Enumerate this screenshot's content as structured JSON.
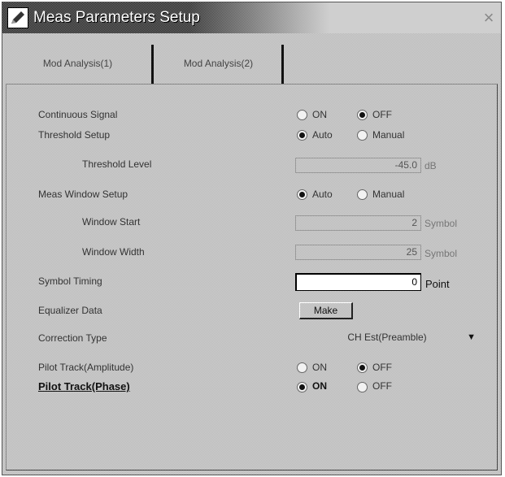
{
  "window": {
    "title": "Meas Parameters Setup",
    "close_glyph": "×"
  },
  "tabs": [
    {
      "label": "Mod Analysis(1)"
    },
    {
      "label": "Mod Analysis(2)"
    }
  ],
  "rows": {
    "continuous_signal": {
      "label": "Continuous Signal",
      "options": [
        "ON",
        "OFF"
      ],
      "selected": "OFF"
    },
    "threshold_setup": {
      "label": "Threshold Setup",
      "options": [
        "Auto",
        "Manual"
      ],
      "selected": "Auto"
    },
    "threshold_level": {
      "label": "Threshold Level",
      "value": "-45.0",
      "unit": "dB"
    },
    "meas_window_setup": {
      "label": "Meas Window Setup",
      "options": [
        "Auto",
        "Manual"
      ],
      "selected": "Auto"
    },
    "window_start": {
      "label": "Window Start",
      "value": "2",
      "unit": "Symbol"
    },
    "window_width": {
      "label": "Window Width",
      "value": "25",
      "unit": "Symbol"
    },
    "symbol_timing": {
      "label": "Symbol Timing",
      "value": "0",
      "unit": "Point"
    },
    "equalizer_data": {
      "label": "Equalizer Data",
      "button": "Make"
    },
    "correction_type": {
      "label": "Correction Type",
      "value": "CH Est(Preamble)"
    },
    "pilot_track_amplitude": {
      "label": "Pilot Track(Amplitude)",
      "options": [
        "ON",
        "OFF"
      ],
      "selected": "OFF"
    },
    "pilot_track_phase": {
      "label": "Pilot Track(Phase)",
      "options": [
        "ON",
        "OFF"
      ],
      "selected": "ON"
    }
  },
  "icons": {
    "app": "pencil-icon",
    "dropdown": "chevron-down-icon"
  }
}
